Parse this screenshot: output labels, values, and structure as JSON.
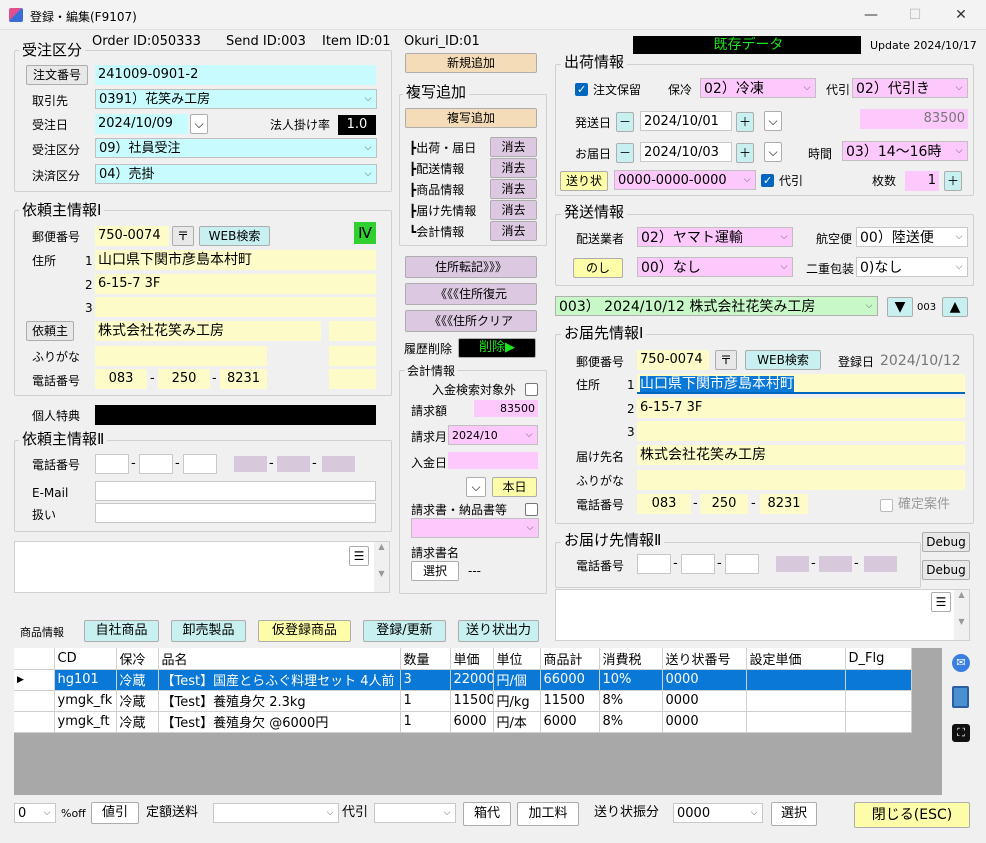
{
  "window": {
    "title": "登録・編集(F9107)",
    "min": "—",
    "max": "☐",
    "close": "✕"
  },
  "ids": {
    "order": "Order ID:050333",
    "send": "Send ID:003",
    "item": "Item ID:01",
    "okuri": "Okuri_ID:01"
  },
  "status": {
    "existing": "既存データ",
    "update": "Update 2024/10/17"
  },
  "order": {
    "title": "受注区分",
    "order_no_btn": "注文番号",
    "order_no": "241009-0901-2",
    "client_label": "取引先",
    "client": "0391）花笑み工房",
    "date_label": "受注日",
    "date": "2024/10/09",
    "rate_label": "法人掛け率",
    "rate": "1.0",
    "kubun_label": "受注区分",
    "kubun": "09）社員受注",
    "settle_label": "決済区分",
    "settle": "04）売掛"
  },
  "mid": {
    "new_btn": "新規追加",
    "copy_title": "複写追加",
    "copy_btn": "複写追加",
    "rows": [
      {
        "label": "┣出荷・届日",
        "btn": "消去"
      },
      {
        "label": "┣配送情報",
        "btn": "消去"
      },
      {
        "label": "┣商品情報",
        "btn": "消去"
      },
      {
        "label": "┣届け先情報",
        "btn": "消去"
      },
      {
        "label": "┗会計情報",
        "btn": "消去"
      }
    ],
    "addr_copy": "住所転記》》》",
    "addr_restore": "《《《住所復元",
    "addr_clear": "《《《住所クリア",
    "hist_label": "履歴削除",
    "hist_btn": "削除▶"
  },
  "acct": {
    "title": "会計情報",
    "exclude": "入金検索対象外",
    "bill_label": "請求額",
    "bill": "83500",
    "month_label": "請求月",
    "month": "2024/10",
    "paid_label": "入金日",
    "today_btn": "本日",
    "docs_label": "請求書・納品書等",
    "docname_label": "請求書名",
    "select_btn": "選択",
    "docname": "---"
  },
  "req1": {
    "title": "依頼主情報Ⅰ",
    "zip_label": "郵便番号",
    "zip": "750-0074",
    "zip_mark": "〒",
    "web_btn": "WEB検索",
    "badge": "Ⅳ",
    "addr_label": "住所",
    "n1": "1",
    "n2": "2",
    "n3": "3",
    "addr1": "山口県下関市彦島本村町",
    "addr2": "6-15-7 3F",
    "addr3": "",
    "req_btn": "依頼主",
    "name": "株式会社花笑み工房",
    "kana_label": "ふりがな",
    "tel_label": "電話番号",
    "tel1": "083",
    "tel2": "250",
    "tel3": "8231",
    "dash": "-",
    "perk_label": "個人特典"
  },
  "req2": {
    "title": "依頼主情報Ⅱ",
    "tel_label": "電話番号",
    "email_label": "E-Mail",
    "handle_label": "扱い"
  },
  "ship": {
    "title": "出荷情報",
    "hold_label": "注文保留",
    "cool_label": "保冷",
    "cool": "02）冷凍",
    "daibiki_label": "代引",
    "daibiki": "02）代引き",
    "ship_date_label": "発送日",
    "ship_date": "2024/10/01",
    "amount": "83500",
    "deliv_date_label": "お届日",
    "deliv_date": "2024/10/03",
    "time_label": "時間",
    "time": "03）14〜16時",
    "okuri_btn": "送り状",
    "okuri": "0000-0000-0000",
    "daibiki2_label": "代引",
    "count_label": "枚数",
    "count": "1",
    "minus": "－",
    "plus": "＋"
  },
  "send": {
    "title": "発送情報",
    "carrier_label": "配送業者",
    "carrier": "02）ヤマト運輸",
    "air_label": "航空便",
    "air": "00）陸送便",
    "noshi_btn": "のし",
    "noshi": "00）なし",
    "double_label": "二重包装",
    "double": "0)なし"
  },
  "nav": {
    "dest": "003） 2024/10/12 株式会社花笑み工房",
    "down": "▼",
    "num": "003",
    "up": "▲"
  },
  "dest1": {
    "title": "お届先情報Ⅰ",
    "zip_label": "郵便番号",
    "zip": "750-0074",
    "zip_mark": "〒",
    "web_btn": "WEB検索",
    "reg_label": "登録日",
    "reg": "2024/10/12",
    "addr_label": "住所",
    "n1": "1",
    "n2": "2",
    "n3": "3",
    "addr1": "山口県下関市彦島本村町",
    "addr2": "6-15-7 3F",
    "name_label": "届け先名",
    "name": "株式会社花笑み工房",
    "kana_label": "ふりがな",
    "tel_label": "電話番号",
    "tel1": "083",
    "tel2": "250",
    "tel3": "8231",
    "confirm_label": "確定案件"
  },
  "dest2": {
    "title": "お届け先情報Ⅱ",
    "tel_label": "電話番号",
    "debug1": "Debug",
    "debug2": "Debug"
  },
  "goods": {
    "label": "商品情報",
    "b1": "自社商品",
    "b2": "卸売製品",
    "b3": "仮登録商品",
    "b4": "登録/更新",
    "b5": "送り状出力"
  },
  "table": {
    "headers": [
      "CD",
      "保冷",
      "品名",
      "数量",
      "単価",
      "単位",
      "商品計",
      "消費税",
      "送り状番号",
      "設定単価",
      "D_Flg"
    ],
    "rows": [
      [
        "hg101",
        "冷蔵",
        "【Test】国産とらふぐ料理セット 4人前",
        "3",
        "22000",
        "円/個",
        "66000",
        "10%",
        "0000",
        "",
        ""
      ],
      [
        "ymgk_fk",
        "冷蔵",
        "【Test】養殖身欠 2.3kg",
        "1",
        "11500",
        "円/kg",
        "11500",
        "8%",
        "0000",
        "",
        ""
      ],
      [
        "ymgk_ft",
        "冷蔵",
        "【Test】養殖身欠 @6000円",
        "1",
        "6000",
        "円/本",
        "6000",
        "8%",
        "0000",
        "",
        ""
      ]
    ]
  },
  "bottom": {
    "pct": "0",
    "off_label": "%off",
    "discount_btn": "値引",
    "fixed_label": "定額送料",
    "daibiki_label": "代引",
    "box_btn": "箱代",
    "proc_btn": "加工料",
    "okuri_label": "送り状振分",
    "okuri": "0000",
    "select_btn": "選択",
    "close_btn": "閉じる(ESC)"
  },
  "memo_icon": "☰"
}
